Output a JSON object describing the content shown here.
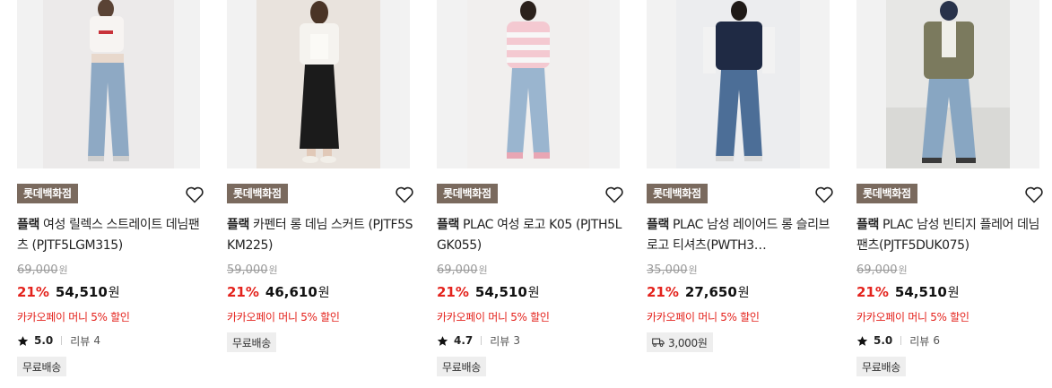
{
  "products": [
    {
      "store_badge": "롯데백화점",
      "brand": "플랙",
      "name": "여성 릴렉스 스트레이트 데님팬츠 (PJTF5LGM315)",
      "original_price": "69,000",
      "discount": "21%",
      "sale_price": "54,510",
      "currency": "원",
      "promo": "카카오페이 머니 5% 할인",
      "rating": "5.0",
      "review_label": "리뷰",
      "review_count": "4",
      "tag": "무료배송"
    },
    {
      "store_badge": "롯데백화점",
      "brand": "플랙",
      "name": "카펜터 롱 데님 스커트 (PJTF5SKM225)",
      "original_price": "59,000",
      "discount": "21%",
      "sale_price": "46,610",
      "currency": "원",
      "promo": "카카오페이 머니 5% 할인",
      "tag": "무료배송"
    },
    {
      "store_badge": "롯데백화점",
      "brand": "플랙",
      "name": "PLAC 여성 로고 K05 (PJTH5LGK055)",
      "original_price": "69,000",
      "discount": "21%",
      "sale_price": "54,510",
      "currency": "원",
      "promo": "카카오페이 머니 5% 할인",
      "rating": "4.7",
      "review_label": "리뷰",
      "review_count": "3",
      "tag": "무료배송"
    },
    {
      "store_badge": "롯데백화점",
      "brand": "플랙",
      "name": "PLAC 남성 레이어드 롱 슬리브 로고 티셔츠(PWTH3…",
      "original_price": "35,000",
      "discount": "21%",
      "sale_price": "27,650",
      "currency": "원",
      "promo": "카카오페이 머니 5% 할인",
      "shipping_fee": "3,000원"
    },
    {
      "store_badge": "롯데백화점",
      "brand": "플랙",
      "name": "PLAC 남성 빈티지 플레어 데님팬츠(PJTF5DUK075)",
      "original_price": "69,000",
      "discount": "21%",
      "sale_price": "54,510",
      "currency": "원",
      "promo": "카카오페이 머니 5% 할인",
      "rating": "5.0",
      "review_label": "리뷰",
      "review_count": "6",
      "tag": "무료배송"
    }
  ],
  "icons": {
    "wishlist": "heart-outline-icon",
    "rating": "star-icon",
    "shipping": "truck-icon"
  },
  "colors": {
    "badge_bg": "#7a6a5e",
    "discount": "#e4231d",
    "promo": "#e4231d"
  }
}
